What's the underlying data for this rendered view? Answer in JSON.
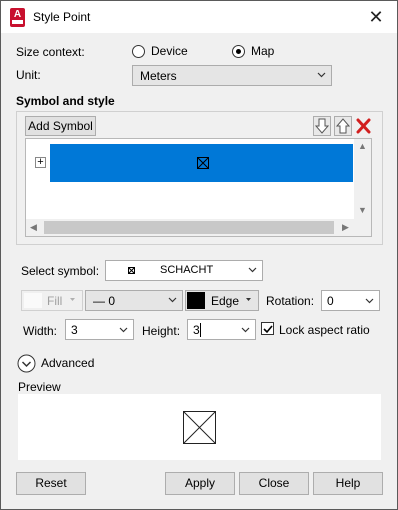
{
  "window": {
    "title": "Style Point",
    "app_icon_letter": "A"
  },
  "size_context": {
    "label": "Size context:",
    "options": [
      {
        "label": "Device",
        "selected": false
      },
      {
        "label": "Map",
        "selected": true
      }
    ]
  },
  "unit": {
    "label": "Unit:",
    "value": "Meters"
  },
  "symbol_style": {
    "heading": "Symbol and style",
    "add_symbol_label": "Add Symbol",
    "expand_glyph": "+"
  },
  "select_symbol": {
    "label": "Select symbol:",
    "value": "SCHACHT"
  },
  "fill": {
    "label": "Fill",
    "enabled": false
  },
  "line_style": {
    "value": "— 0"
  },
  "edge": {
    "label": "Edge",
    "color": "#000000"
  },
  "rotation": {
    "label": "Rotation:",
    "value": "0"
  },
  "width": {
    "label": "Width:",
    "value": "3"
  },
  "height": {
    "label": "Height:",
    "value": "3"
  },
  "lock_aspect": {
    "label": "Lock aspect ratio",
    "checked": true
  },
  "advanced": {
    "label": "Advanced"
  },
  "preview": {
    "label": "Preview"
  },
  "buttons": {
    "reset": "Reset",
    "apply": "Apply",
    "close": "Close",
    "help": "Help"
  },
  "colors": {
    "selection": "#0078d7",
    "app_icon": "#c8102e",
    "delete_red": "#d21f1f"
  }
}
